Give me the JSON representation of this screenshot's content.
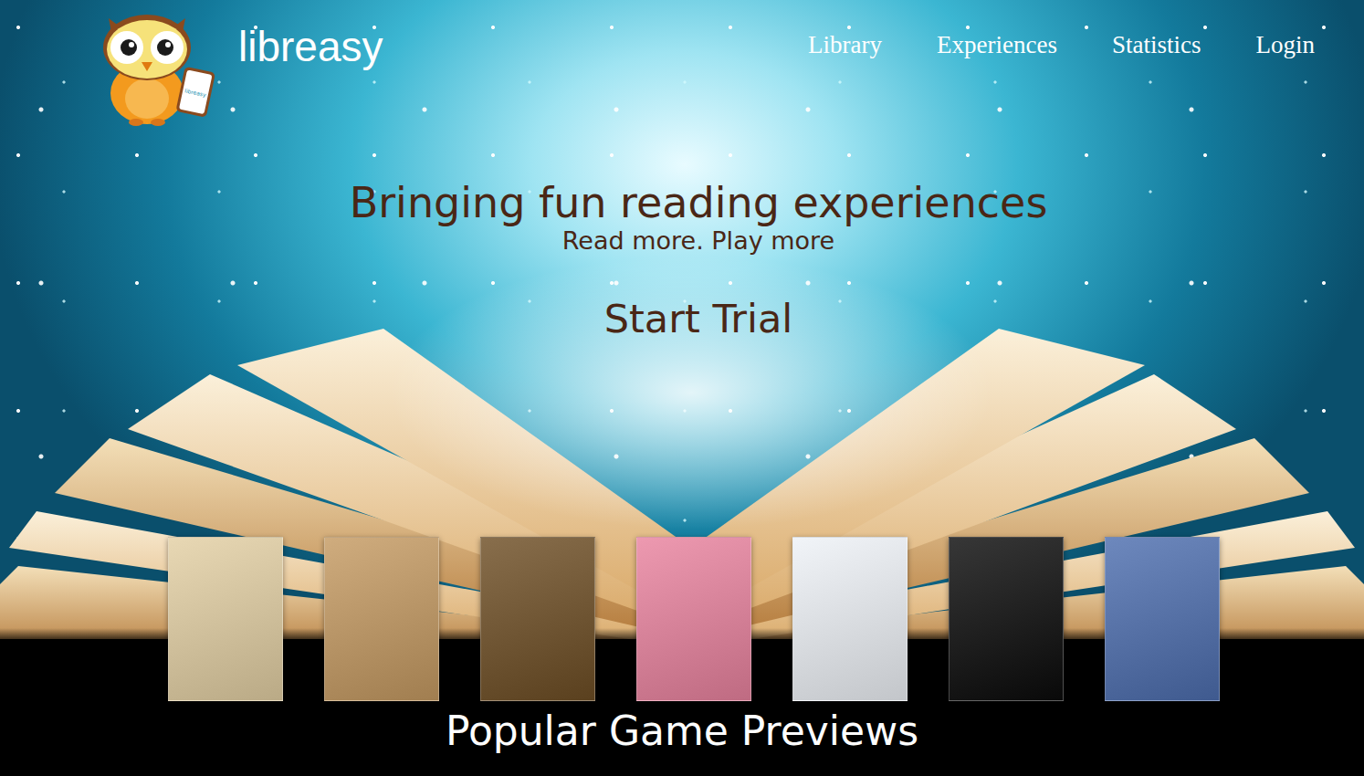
{
  "header": {
    "brand": "libreasy",
    "logo_badge": "libreasy",
    "nav": [
      "Library",
      "Experiences",
      "Statistics",
      "Login"
    ]
  },
  "hero": {
    "title": "Bringing fun reading experiences",
    "subtitle": "Read more. Play more",
    "cta": "Start Trial"
  },
  "previews": {
    "title": "Popular Game Previews",
    "books": [
      {
        "color": "#e3cfa3"
      },
      {
        "color": "#c49a62"
      },
      {
        "color": "#6e4e24"
      },
      {
        "color": "#e9839f"
      },
      {
        "color": "#eef1f6"
      },
      {
        "color": "#0b0b0b"
      },
      {
        "color": "#4d6eae"
      }
    ]
  }
}
